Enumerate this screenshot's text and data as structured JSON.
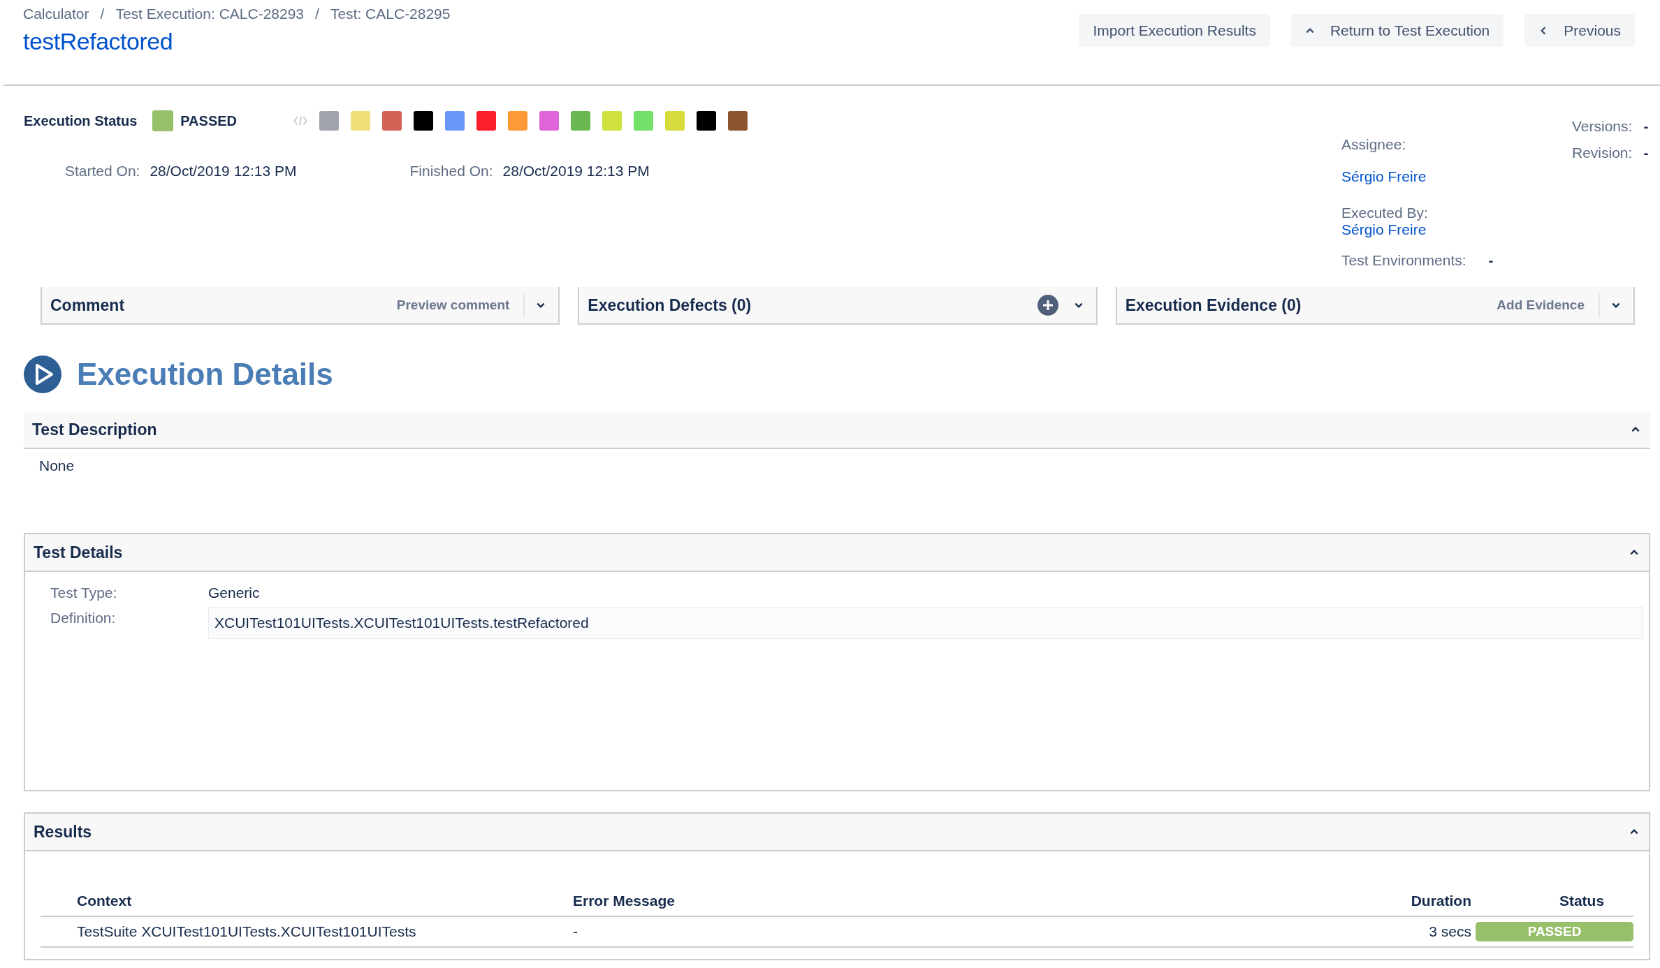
{
  "breadcrumbs": [
    "Calculator",
    "Test Execution: CALC-28293",
    "Test: CALC-28295"
  ],
  "breadcrumb_separator": "/",
  "title": "testRefactored",
  "header_buttons": [
    {
      "label": "Import Execution Results",
      "kind": "plain"
    },
    {
      "label": "Return to Test Execution",
      "kind": "up"
    },
    {
      "label": "Previous",
      "kind": "back"
    }
  ],
  "execution_status": {
    "label": "Execution Status",
    "status": "PASSED",
    "color": "#97c06a"
  },
  "status_swatches": [
    {
      "color": "#a0a4ad"
    },
    {
      "color": "#f0df78"
    },
    {
      "color": "#d46256"
    },
    {
      "color": "#000000"
    },
    {
      "color": "#6a96f8"
    },
    {
      "color": "#fc1d2d"
    },
    {
      "color": "#fd9a36"
    },
    {
      "color": "#df66d8"
    },
    {
      "color": "#6ab850"
    },
    {
      "color": "#cfe23e"
    },
    {
      "color": "#73e069"
    },
    {
      "color": "#d6dc3b"
    },
    {
      "color": "#000000"
    },
    {
      "color": "#8b5530"
    }
  ],
  "started": {
    "label": "Started On:",
    "value": "28/Oct/2019 12:13 PM"
  },
  "finished": {
    "label": "Finished On:",
    "value": "28/Oct/2019 12:13 PM"
  },
  "assignee": {
    "label": "Assignee:",
    "value": "Sérgio Freire"
  },
  "executed_by": {
    "label": "Executed By:",
    "value": "Sérgio Freire"
  },
  "test_environments": {
    "label": "Test Environments:",
    "value": "-"
  },
  "versions": {
    "label": "Versions:",
    "value": "-"
  },
  "revision": {
    "label": "Revision:",
    "value": "-"
  },
  "panels": [
    {
      "title": "Comment",
      "kind": "action",
      "action": "Preview comment"
    },
    {
      "title": "Execution Defects (0)",
      "kind": "add"
    },
    {
      "title": "Execution Evidence (0)",
      "kind": "action",
      "action": "Add Evidence"
    }
  ],
  "section_title": "Execution Details",
  "test_description": {
    "title": "Test Description",
    "expanded": true,
    "text": "None"
  },
  "test_details": {
    "title": "Test Details",
    "expanded": true,
    "fields": [
      {
        "label": "Test Type:",
        "value": "Generic",
        "kind": "text"
      },
      {
        "label": "Definition:",
        "value": "XCUITest101UITests.XCUITest101UITests.testRefactored",
        "kind": "code"
      }
    ]
  },
  "results": {
    "title": "Results",
    "expanded": true,
    "columns": [
      "Context",
      "Error Message",
      "Duration",
      "Status"
    ],
    "rows": [
      {
        "context": "TestSuite XCUITest101UITests.XCUITest101UITests",
        "error": "-",
        "duration": "3 secs",
        "status": "PASSED",
        "color": "#97c06a"
      }
    ]
  }
}
